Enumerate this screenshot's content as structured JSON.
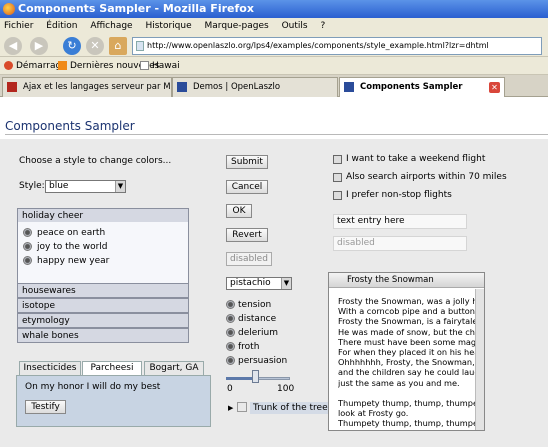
{
  "browser": {
    "window_title": "Components Sampler - Mozilla Firefox",
    "menu": [
      "Fichier",
      "Édition",
      "Affichage",
      "Historique",
      "Marque-pages",
      "Outils",
      "?"
    ],
    "url": "http://www.openlaszlo.org/lps4/examples/components/style_example.html?lzr=dhtml",
    "bookmarks": [
      "Démarrage",
      "Dernières nouvelles",
      "Hawai"
    ],
    "tabs": [
      "Ajax et les langages serveur par Maxi...",
      "Demos | OpenLaszlo",
      "Components Sampler"
    ]
  },
  "page": {
    "title": "Components Sampler",
    "choose_label": "Choose a style to change colors...",
    "style_label": "Style:",
    "style_value": "blue",
    "accordion": {
      "headers": [
        "holiday cheer",
        "housewares",
        "isotope",
        "etymology",
        "whale bones"
      ],
      "items": [
        "peace on earth",
        "joy to the world",
        "happy new year"
      ]
    },
    "tabs": {
      "labels": [
        "Insecticides",
        "Parcheesi",
        "Bogart, GA"
      ],
      "selected": "Parcheesi",
      "text": "On my honor I will do my best",
      "button": "Testify"
    },
    "buttons": {
      "submit": "Submit",
      "cancel": "Cancel",
      "ok": "OK",
      "revert": "Revert",
      "disabled": "disabled"
    },
    "combo_value": "pistachio",
    "radios": [
      "tension",
      "distance",
      "delerium",
      "froth",
      "persuasion"
    ],
    "slider": {
      "min": "0",
      "max": "100",
      "value": 45
    },
    "tree_label": "Trunk of the tree",
    "checkboxes": [
      "I want to take a weekend flight",
      "Also search airports within 70 miles",
      "I prefer non-stop flights"
    ],
    "text_entry": "text entry here",
    "disabled_field": "disabled",
    "window": {
      "title": "Frosty the Snowman",
      "text": "Frosty the Snowman, was a jolly hap\nWith a corncob pipe and a button no:\nFrosty the Snowman, is a fairytale, t\nHe was made of snow, but the childr\nThere must have been some magic i\nFor when they placed it on his head,\nOhhhhhhh, Frosty, the Snowman, wa\nand the children say he could laugh a\njust the same as you and me.\n\nThumpety thump, thump, thumpety t\nlook at Frosty go.\nThumpety thump, thump, thumpety t\nover the hills of snow."
    }
  },
  "colors": {
    "title_blue": "#1b3370",
    "accordion": "#d5d8e2",
    "tab_panel": "#c8d4e3"
  }
}
